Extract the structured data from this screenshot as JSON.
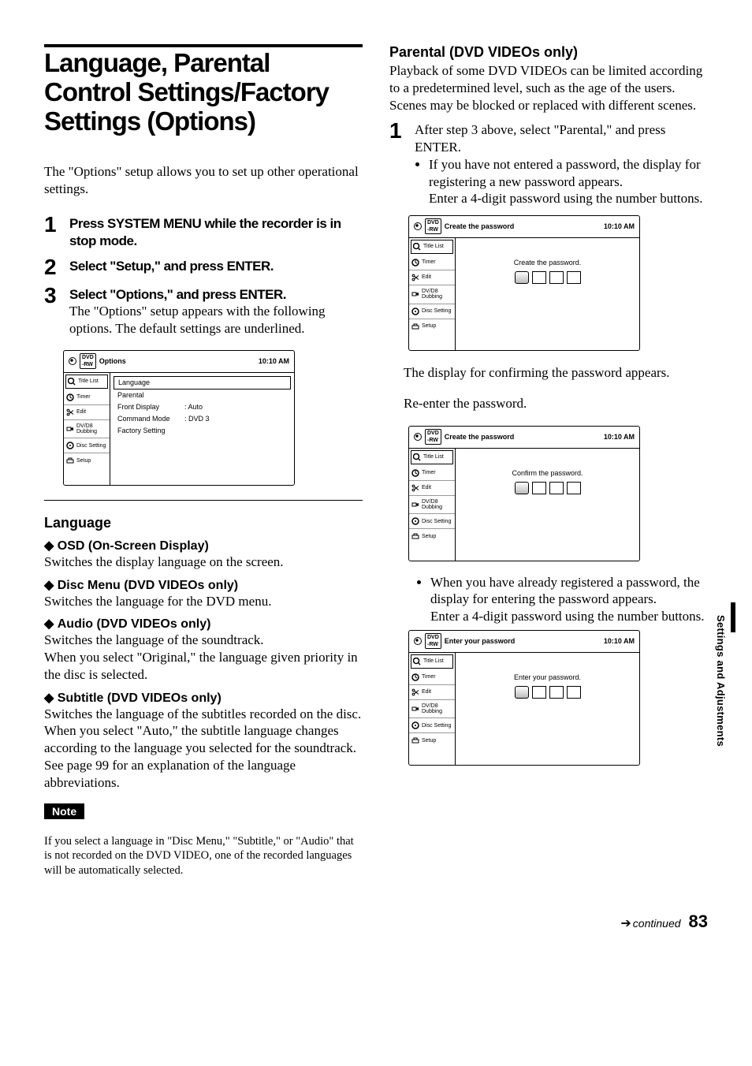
{
  "side_tab": "Settings and Adjustments",
  "footer": {
    "continued": "continued",
    "page": "83"
  },
  "left": {
    "title": "Language, Parental Control Settings/Factory Settings (Options)",
    "intro": "The \"Options\" setup allows you to set up other operational settings.",
    "steps": [
      {
        "num": "1",
        "head": "Press SYSTEM MENU while the recorder is in stop mode."
      },
      {
        "num": "2",
        "head": "Select \"Setup,\" and press ENTER."
      },
      {
        "num": "3",
        "head": "Select \"Options,\" and press ENTER.",
        "body": "The \"Options\" setup appears with the following options. The default settings are underlined."
      }
    ],
    "osd": {
      "title": "Options",
      "time": "10:10 AM",
      "side": [
        "Title List",
        "Timer",
        "Edit",
        "DV/D8 Dubbing",
        "Disc Setting",
        "Setup"
      ],
      "opts": [
        {
          "label": "Language"
        },
        {
          "label": "Parental"
        },
        {
          "label": "Front Display",
          "value": "Auto"
        },
        {
          "label": "Command Mode",
          "value": "DVD 3"
        },
        {
          "label": "Factory Setting"
        }
      ]
    },
    "lang_section_title": "Language",
    "diamond": [
      {
        "head": "OSD (On-Screen Display)",
        "body": "Switches the display language on the screen."
      },
      {
        "head": "Disc Menu (DVD VIDEOs only)",
        "body": "Switches the language for the DVD menu."
      },
      {
        "head": "Audio (DVD VIDEOs only)",
        "body": "Switches the language of the soundtrack.\nWhen you select \"Original,\" the language given priority in the disc is selected."
      },
      {
        "head": "Subtitle (DVD VIDEOs only)",
        "body": "Switches the language of the subtitles recorded on the disc.\nWhen you select \"Auto,\" the subtitle language changes according to the language you selected for the soundtrack. See page 99 for an explanation of the language abbreviations."
      }
    ],
    "note_label": "Note",
    "note_body": "If you select a language in \"Disc Menu,\" \"Subtitle,\" or \"Audio\" that is not recorded on the DVD VIDEO, one of the recorded languages will be automatically selected."
  },
  "right": {
    "heading": "Parental (DVD VIDEOs only)",
    "intro": "Playback of some DVD VIDEOs can be limited according to a predetermined level, such as the age of the users. Scenes may be blocked or replaced with different scenes.",
    "step1_num": "1",
    "step1_body": "After step 3 above, select \"Parental,\" and press ENTER.",
    "bullet1a": "If you have not entered a password, the display for registering a new password appears.",
    "bullet1b": "Enter a 4-digit password using the number buttons.",
    "osd_create": {
      "title": "Create the password",
      "time": "10:10 AM",
      "msg": "Create the password."
    },
    "mid_text1": "The display for confirming the password appears.",
    "mid_text2": "Re-enter the password.",
    "osd_confirm": {
      "title": "Create the password",
      "time": "10:10 AM",
      "msg": "Confirm the password."
    },
    "bullet2a": "When you have already registered a password, the display for entering the password appears.",
    "bullet2b": "Enter a 4-digit password using the number buttons.",
    "osd_enter": {
      "title": "Enter your password",
      "time": "10:10 AM",
      "msg": "Enter your password."
    },
    "side": [
      "Title List",
      "Timer",
      "Edit",
      "DV/D8 Dubbing",
      "Disc Setting",
      "Setup"
    ]
  }
}
